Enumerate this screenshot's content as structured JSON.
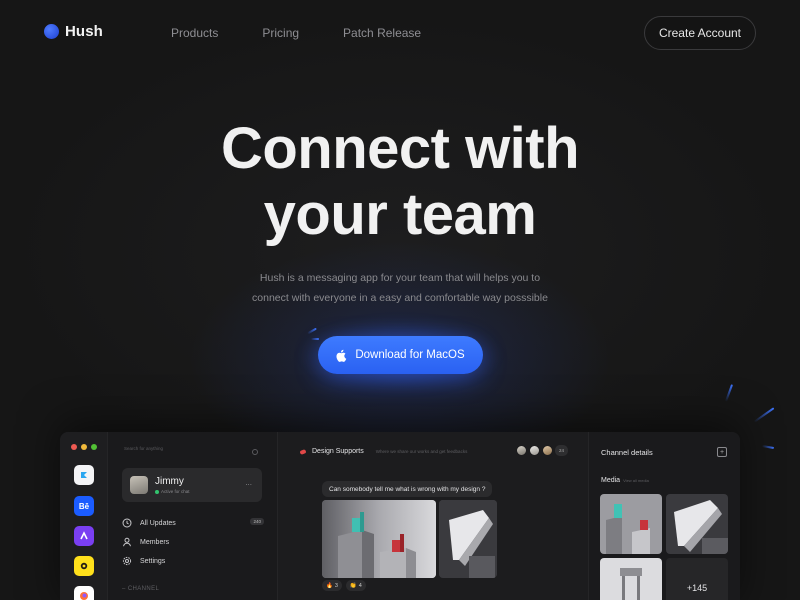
{
  "nav": {
    "brand": "Hush",
    "links": [
      "Products",
      "Pricing",
      "Patch Release"
    ],
    "cta": "Create Account"
  },
  "hero": {
    "title_line1": "Connect with",
    "title_line2": "your team",
    "subtitle_line1": "Hush is a messaging app for your team that will helps you to",
    "subtitle_line2": "connect with everyone in a easy and comfortable way posssible",
    "download_label": "Download for MacOS",
    "download_icon": "apple-icon"
  },
  "colors": {
    "accent": "#3e7bff",
    "background": "#161616",
    "online": "#32c46e"
  },
  "app": {
    "search_placeholder": "Search for anything",
    "profile": {
      "name": "Jimmy",
      "status": "Active for chat",
      "more": "..."
    },
    "menu": [
      {
        "label": "All Updates",
        "icon": "clock-icon",
        "badge": "240"
      },
      {
        "label": "Members",
        "icon": "user-icon"
      },
      {
        "label": "Settings",
        "icon": "gear-icon"
      }
    ],
    "channel_header": "CHANNEL",
    "channel": {
      "title": "Design Supports",
      "description": "Where we share our works and get feedbacks",
      "member_extra": "24"
    },
    "message": "Can somebody tell me what is wrong with my design ?",
    "reactions": [
      {
        "emoji": "🔥",
        "count": "3"
      },
      {
        "emoji": "👏",
        "count": "4"
      }
    ],
    "details": {
      "title": "Channel details",
      "media_label": "Media",
      "media_sub": "View all media",
      "more_count": "+145"
    }
  }
}
